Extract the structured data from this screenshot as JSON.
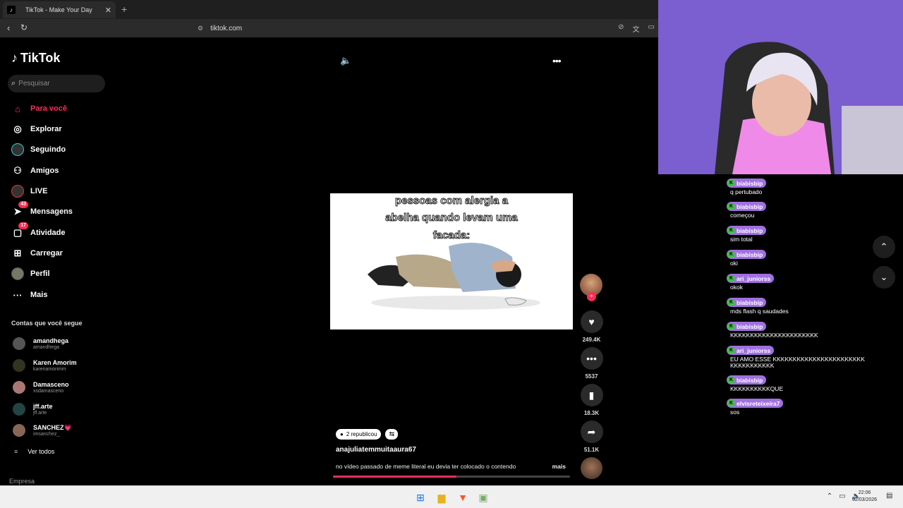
{
  "browser": {
    "tab_title": "TikTok - Make Your Day",
    "new_tab": "+",
    "close": "✕",
    "url": "tiktok.com"
  },
  "sidebar": {
    "logo": "TikTok",
    "search_placeholder": "Pesquisar",
    "nav": [
      {
        "label": "Para você",
        "icon": "home-icon"
      },
      {
        "label": "Explorar",
        "icon": "compass-icon"
      },
      {
        "label": "Seguindo",
        "icon": "following-icon"
      },
      {
        "label": "Amigos",
        "icon": "friends-icon"
      },
      {
        "label": "LIVE",
        "icon": "live-icon"
      },
      {
        "label": "Mensagens",
        "icon": "message-icon",
        "badge": "43"
      },
      {
        "label": "Atividade",
        "icon": "activity-icon",
        "badge": "17"
      },
      {
        "label": "Carregar",
        "icon": "upload-icon"
      },
      {
        "label": "Perfil",
        "icon": "profile-icon"
      },
      {
        "label": "Mais",
        "icon": "more-icon"
      }
    ],
    "following_title": "Contas que você segue",
    "following": [
      {
        "name": "amandhega",
        "handle": "amandhega"
      },
      {
        "name": "Karen Amorim",
        "handle": "karenamorimm"
      },
      {
        "name": "Damasceno",
        "handle": "xsdamasceno"
      },
      {
        "name": "jff.arte",
        "handle": "jff.arte"
      },
      {
        "name": "SANCHEZ💗",
        "handle": "imsanchez_"
      }
    ],
    "see_all": "Ver todos",
    "company": "Empresa"
  },
  "video": {
    "caption_lines": [
      "pessoas com alergia a",
      "abelha quando levam uma",
      "facada:"
    ],
    "reposts": "2 republicou",
    "author": "anajuliatemmuitaaura67",
    "description": "no vídeo passado de meme literal eu devia ter colocado o contendo",
    "more": "mais",
    "progress": 0.52
  },
  "actions": {
    "likes": "249.4K",
    "comments": "5537",
    "saves": "18.3K",
    "shares": "51.1K"
  },
  "chat": [
    {
      "user": "biabisbip",
      "msg": "q pertubado"
    },
    {
      "user": "biabisbip",
      "msg": "começou"
    },
    {
      "user": "biabisbip",
      "msg": "sim total"
    },
    {
      "user": "biabisbip",
      "msg": "oki"
    },
    {
      "user": "ari_juniorss",
      "msg": "okok"
    },
    {
      "user": "biabisbip",
      "msg": "mds flash q saudades"
    },
    {
      "user": "biabisbip",
      "msg": "KKKKKKKKKKKKKKKKKKKKKK"
    },
    {
      "user": "ari_juniorss",
      "msg": "EU AMO ESSE KKKKKKKKKKKKKKKKKKKKKKKKKKKKKKKKKK"
    },
    {
      "user": "biabisbip",
      "msg": "KKKKKKKKKKQUE"
    },
    {
      "user": "elvisreteixeira7",
      "msg": "sos"
    }
  ],
  "taskbar": {
    "time": "22:06",
    "date": "02/03/2026"
  },
  "colors": {
    "accent": "#fe2c55",
    "chat_user_bg": "#a070e0"
  }
}
